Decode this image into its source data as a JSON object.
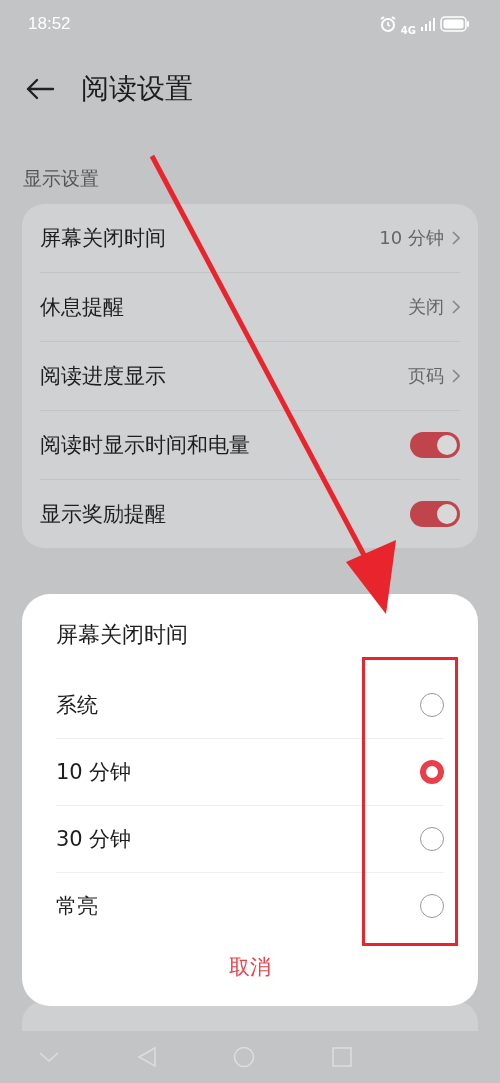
{
  "status_bar": {
    "time": "18:52",
    "network": "4G"
  },
  "header": {
    "title": "阅读设置"
  },
  "sections": [
    {
      "title": "显示设置",
      "rows": [
        {
          "kind": "value",
          "label": "屏幕关闭时间",
          "value": "10 分钟"
        },
        {
          "kind": "value",
          "label": "休息提醒",
          "value": "关闭"
        },
        {
          "kind": "value",
          "label": "阅读进度显示",
          "value": "页码"
        },
        {
          "kind": "toggle",
          "label": "阅读时显示时间和电量",
          "on": true
        },
        {
          "kind": "toggle",
          "label": "显示奖励提醒",
          "on": true
        }
      ]
    }
  ],
  "dialog": {
    "title": "屏幕关闭时间",
    "options": [
      {
        "label": "系统",
        "selected": false
      },
      {
        "label": "10 分钟",
        "selected": true
      },
      {
        "label": "30 分钟",
        "selected": false
      },
      {
        "label": "常亮",
        "selected": false
      }
    ],
    "cancel": "取消"
  }
}
